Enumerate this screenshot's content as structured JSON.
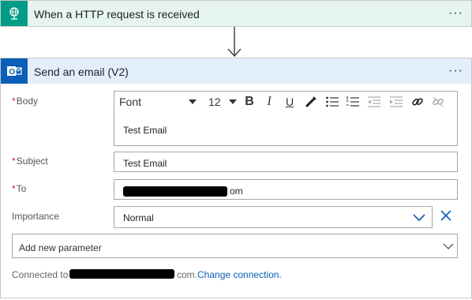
{
  "trigger": {
    "title": "When a HTTP request is received",
    "icon": "globe-request-icon",
    "more_label": "···",
    "color": "#009c87"
  },
  "action": {
    "title": "Send an email (V2)",
    "icon": "outlook-icon",
    "more_label": "···",
    "color": "#0a5fb8"
  },
  "fields": {
    "body": {
      "required_mark": "*",
      "label": "Body",
      "toolbar": {
        "font": "Font",
        "size": "12",
        "bold": "B",
        "italic": "I",
        "underline": "U"
      },
      "value": "Test Email"
    },
    "subject": {
      "required_mark": "*",
      "label": "Subject",
      "value": "Test Email"
    },
    "to": {
      "required_mark": "*",
      "label": "To",
      "value_suffix": "om"
    },
    "importance": {
      "label": "Importance",
      "value": "Normal"
    }
  },
  "add_parameter": {
    "label": "Add new parameter"
  },
  "connection": {
    "prefix": "Connected to",
    "suffix": "com.",
    "change_label": "Change connection."
  }
}
